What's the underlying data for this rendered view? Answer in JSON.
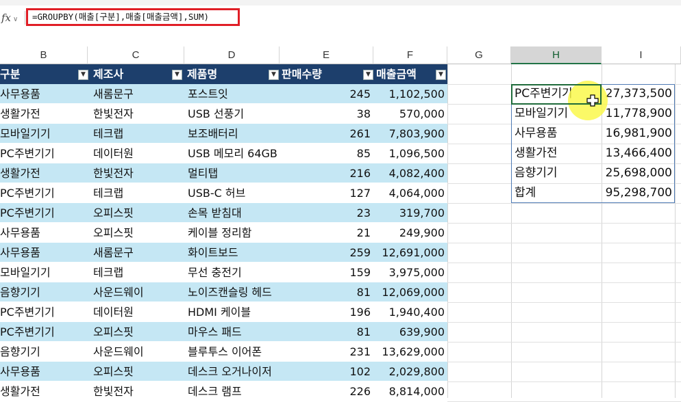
{
  "formula_bar": {
    "fx_label": "fx",
    "formula": "=GROUPBY(매출[구분],매출[매출금액],SUM)"
  },
  "columns": [
    "B",
    "C",
    "D",
    "E",
    "F",
    "G",
    "H",
    "I"
  ],
  "table": {
    "headers": [
      "구분",
      "제조사",
      "제품명",
      "판매수량",
      "매출금액"
    ],
    "rows": [
      [
        "사무용품",
        "새롬문구",
        "포스트잇",
        "245",
        "1,102,500"
      ],
      [
        "생활가전",
        "한빛전자",
        "USB 선풍기",
        "38",
        "570,000"
      ],
      [
        "모바일기기",
        "테크랩",
        "보조배터리",
        "261",
        "7,803,900"
      ],
      [
        "PC주변기기",
        "데이터원",
        "USB 메모리 64GB",
        "85",
        "1,096,500"
      ],
      [
        "생활가전",
        "한빛전자",
        "멀티탭",
        "216",
        "4,082,400"
      ],
      [
        "PC주변기기",
        "테크랩",
        "USB-C 허브",
        "127",
        "4,064,000"
      ],
      [
        "PC주변기기",
        "오피스핏",
        "손목 받침대",
        "23",
        "319,700"
      ],
      [
        "사무용품",
        "오피스핏",
        "케이블 정리함",
        "21",
        "249,900"
      ],
      [
        "사무용품",
        "새롬문구",
        "화이트보드",
        "259",
        "12,691,000"
      ],
      [
        "모바일기기",
        "테크랩",
        "무선 충전기",
        "159",
        "3,975,000"
      ],
      [
        "음향기기",
        "사운드웨이",
        "노이즈캔슬링 헤드",
        "81",
        "12,069,000"
      ],
      [
        "PC주변기기",
        "데이터원",
        "HDMI 케이블",
        "196",
        "1,940,400"
      ],
      [
        "PC주변기기",
        "오피스핏",
        "마우스 패드",
        "81",
        "639,900"
      ],
      [
        "음향기기",
        "사운드웨이",
        "블루투스 이어폰",
        "231",
        "13,629,000"
      ],
      [
        "사무용품",
        "오피스핏",
        "데스크 오거나이저",
        "102",
        "2,029,800"
      ],
      [
        "생활가전",
        "한빛전자",
        "데스크 램프",
        "226",
        "8,814,000"
      ]
    ]
  },
  "groupby_result": [
    [
      "PC주변기기",
      "27,373,500"
    ],
    [
      "모바일기기",
      "11,778,900"
    ],
    [
      "사무용품",
      "16,981,900"
    ],
    [
      "생활가전",
      "13,466,400"
    ],
    [
      "음향기기",
      "25,698,000"
    ],
    [
      "합계",
      "95,298,700"
    ]
  ],
  "selected_cell": "H",
  "colors": {
    "header_bg": "#1d3f6c",
    "band_bg": "#c5e7f4",
    "formula_border": "#e01e26",
    "highlight": "#faf846",
    "result_border": "#4f7bb5"
  },
  "icons": [
    "fx-icon",
    "filter-dropdown-icon",
    "cell-cursor-icon"
  ]
}
